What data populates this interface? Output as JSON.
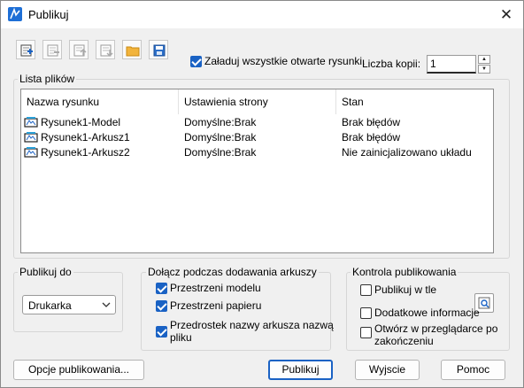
{
  "window": {
    "title": "Publikuj",
    "close_glyph": "✕"
  },
  "toolbar": {
    "icons": [
      "add-sheets-icon",
      "remove-sheets-icon",
      "move-up-icon",
      "move-down-icon",
      "open-folder-icon",
      "save-icon"
    ]
  },
  "load_all": {
    "label": "Załaduj wszystkie otwarte rysunki.",
    "checked": true
  },
  "copies": {
    "label": "Liczba kopii:",
    "value": "1"
  },
  "file_list": {
    "title": "Lista plików",
    "columns": [
      "Nazwa rysunku",
      "Ustawienia strony",
      "Stan"
    ],
    "rows": [
      {
        "name": "Rysunek1-Model",
        "setup": "Domyślne:Brak",
        "status": "Brak błędów"
      },
      {
        "name": "Rysunek1-Arkusz1",
        "setup": "Domyślne:Brak",
        "status": "Brak błędów"
      },
      {
        "name": "Rysunek1-Arkusz2",
        "setup": "Domyślne:Brak",
        "status": "Nie zainicjalizowano układu"
      }
    ]
  },
  "publish_to": {
    "title": "Publikuj do",
    "selected": "Drukarka"
  },
  "include": {
    "title": "Dołącz podczas dodawania arkuszy",
    "model": "Przestrzeni modelu",
    "paper": "Przestrzeni papieru",
    "prefix_line1": "Przedrostek nazwy arkusza nazwą",
    "prefix_line2": "pliku"
  },
  "control": {
    "title": "Kontrola publikowania",
    "background": "Publikuj w tle",
    "extra": "Dodatkowe informacje",
    "open_line1": "Otwórz w przeglądarce po",
    "open_line2": "zakończeniu"
  },
  "buttons": {
    "options": "Opcje publikowania...",
    "publish": "Publikuj",
    "exit": "Wyjscie",
    "help": "Pomoc"
  },
  "colors": {
    "accent": "#1a62c4"
  }
}
